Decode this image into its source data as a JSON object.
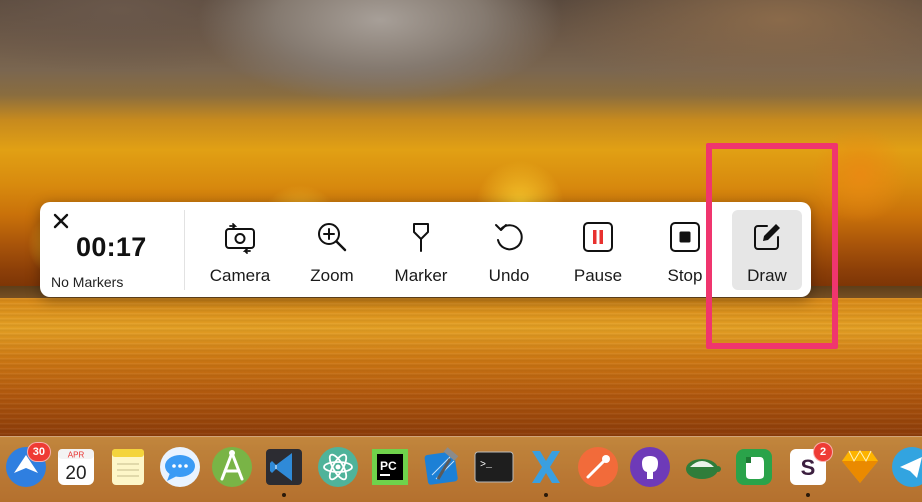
{
  "toolbar": {
    "timer": "00:17",
    "markers_label": "No Markers",
    "tools": [
      {
        "label": "Camera",
        "icon": "camera-switch-icon"
      },
      {
        "label": "Zoom",
        "icon": "zoom-in-icon"
      },
      {
        "label": "Marker",
        "icon": "map-pin-icon"
      },
      {
        "label": "Undo",
        "icon": "undo-icon"
      },
      {
        "label": "Pause",
        "icon": "pause-icon"
      },
      {
        "label": "Stop",
        "icon": "stop-icon"
      },
      {
        "label": "Draw",
        "icon": "pencil-square-icon",
        "active": true
      }
    ]
  },
  "dock": {
    "items": [
      {
        "name": "spark-mail",
        "icon": "mail-paperplane-icon",
        "badge": "30"
      },
      {
        "name": "calendar",
        "icon": "calendar-icon",
        "month": "APR",
        "day": "20"
      },
      {
        "name": "notes",
        "icon": "notes-icon"
      },
      {
        "name": "messages",
        "icon": "chat-bubble-icon"
      },
      {
        "name": "android-studio",
        "icon": "android-studio-icon"
      },
      {
        "name": "visual-studio-code",
        "icon": "vscode-icon",
        "running": true
      },
      {
        "name": "atom",
        "icon": "atom-icon"
      },
      {
        "name": "pycharm",
        "icon": "pycharm-icon",
        "text": "PC"
      },
      {
        "name": "xcode",
        "icon": "xcode-hammer-icon"
      },
      {
        "name": "terminal",
        "icon": "terminal-icon",
        "text": ">_"
      },
      {
        "name": "xamarin",
        "icon": "xamarin-icon",
        "running": true
      },
      {
        "name": "postman",
        "icon": "postman-icon"
      },
      {
        "name": "github-desktop",
        "icon": "github-icon"
      },
      {
        "name": "turtle-app",
        "icon": "turtle-icon"
      },
      {
        "name": "evernote",
        "icon": "evernote-icon"
      },
      {
        "name": "slack",
        "icon": "slack-icon",
        "badge": "2",
        "running": true
      },
      {
        "name": "sketch",
        "icon": "sketch-diamond-icon"
      },
      {
        "name": "telegram",
        "icon": "telegram-icon"
      }
    ]
  },
  "colors": {
    "highlight": "#f0356e",
    "pause_red": "#e8312f",
    "active_tool_bg": "#e6e6e6"
  }
}
